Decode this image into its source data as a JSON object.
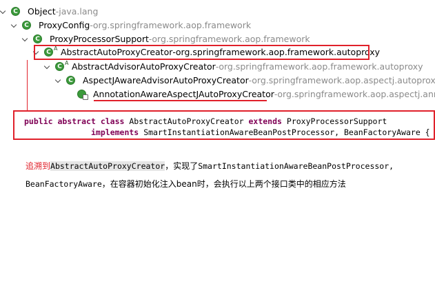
{
  "tree": {
    "rows": [
      {
        "name": "Object",
        "package": "java.lang",
        "abstract": false
      },
      {
        "name": "ProxyConfig",
        "package": "org.springframework.aop.framework",
        "abstract": false
      },
      {
        "name": "ProxyProcessorSupport",
        "package": "org.springframework.aop.framework",
        "abstract": false
      },
      {
        "name": "AbstractAutoProxyCreator",
        "package": "org.springframework.aop.framework.autoproxy",
        "abstract": true,
        "abstract_mark": "A"
      },
      {
        "name": "AbstractAdvisorAutoProxyCreator",
        "package": "org.springframework.aop.framework.autoproxy",
        "abstract": true,
        "abstract_mark": "A"
      },
      {
        "name": "AspectJAwareAdvisorAutoProxyCreator",
        "package": "org.springframework.aop.aspectj.autoproxy",
        "abstract": false
      },
      {
        "name": "AnnotationAwareAspectJAutoProxyCreator",
        "package": "org.springframework.aop.aspectj.annota",
        "abstract": false
      }
    ],
    "separator": " - ",
    "class_icon_letter": "C"
  },
  "code": {
    "line1": {
      "kw1": "public",
      "kw2": "abstract",
      "kw3": "class",
      "name": "AbstractAutoProxyCreator",
      "kw4": "extends",
      "parent": "ProxyProcessorSupport"
    },
    "line2": {
      "kw": "implements",
      "interfaces": "SmartInstantiationAwareBeanPostProcessor, BeanFactoryAware {"
    }
  },
  "note": {
    "lead": "追溯到",
    "cls": "AbstractAutoProxyCreator",
    "mid": "，实现了",
    "iface1": "SmartInstantiationAwareBeanPostProcessor",
    "comma": ",",
    "iface2": "BeanFactoryAware",
    "tail": "，在容器初始化注入bean时，会执行以上两个接口类中的相应方法"
  },
  "colors": {
    "highlight": "#e0202a",
    "class_icon": "#3c9a3c",
    "keyword": "#7f0055",
    "package_text": "#8a8a8a"
  }
}
